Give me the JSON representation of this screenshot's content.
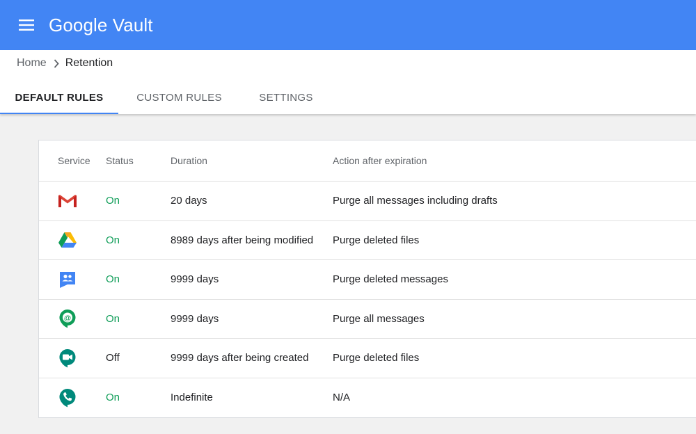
{
  "app": {
    "title": "Google Vault",
    "brand_color": "#4285f4"
  },
  "breadcrumb": {
    "home": "Home",
    "current": "Retention"
  },
  "tabs": [
    {
      "label": "DEFAULT RULES",
      "active": true
    },
    {
      "label": "CUSTOM RULES",
      "active": false
    },
    {
      "label": "SETTINGS",
      "active": false
    }
  ],
  "table": {
    "headers": {
      "service": "Service",
      "status": "Status",
      "duration": "Duration",
      "action": "Action after expiration"
    },
    "rows": [
      {
        "service_icon": "gmail-icon",
        "status": "On",
        "duration": "20 days",
        "action": "Purge all messages including drafts"
      },
      {
        "service_icon": "drive-icon",
        "status": "On",
        "duration": "8989 days after being modified",
        "action": "Purge deleted files"
      },
      {
        "service_icon": "groups-icon",
        "status": "On",
        "duration": "9999 days",
        "action": "Purge deleted messages"
      },
      {
        "service_icon": "hangouts-chat-icon",
        "status": "On",
        "duration": "9999 days",
        "action": "Purge all messages"
      },
      {
        "service_icon": "meet-icon",
        "status": "Off",
        "duration": "9999 days after being created",
        "action": "Purge deleted files"
      },
      {
        "service_icon": "voice-icon",
        "status": "On",
        "duration": "Indefinite",
        "action": "N/A"
      }
    ],
    "status_colors": {
      "on": "#0f9d58",
      "off": "#202124"
    }
  }
}
